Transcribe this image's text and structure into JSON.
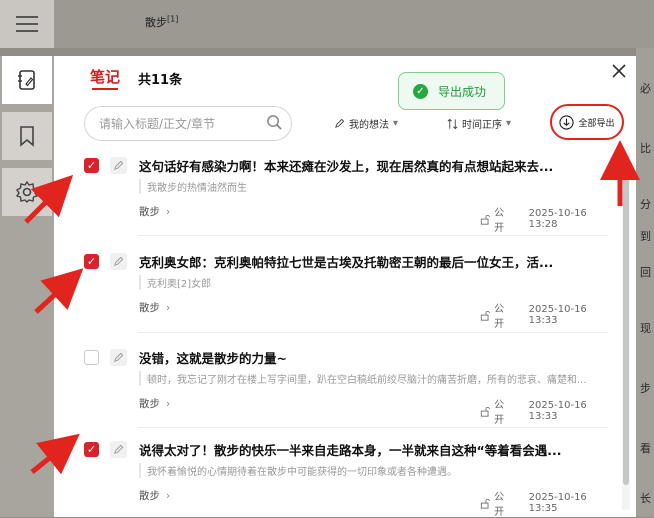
{
  "reader": {
    "bg_text": "散步",
    "bg_sup": "[1]",
    "bg_glyphs": [
      "必",
      "比",
      "分",
      "到",
      "回",
      "现",
      "步",
      "看",
      "长"
    ]
  },
  "sidebar": {
    "items": [
      {
        "name": "notes",
        "icon": "notebook-icon",
        "active": true
      },
      {
        "name": "bookmarks",
        "icon": "bookmark-icon",
        "active": false
      },
      {
        "name": "settings",
        "icon": "gear-icon",
        "active": false
      }
    ]
  },
  "panel": {
    "tab_label": "笔记",
    "count_label": "共11条",
    "toast_label": "导出成功",
    "search_placeholder": "请输入标题/正文/章节",
    "filter_mine": "我的想法",
    "filter_sort": "时间正序",
    "export_label": "全部导出"
  },
  "entries": [
    {
      "checked": true,
      "title": "这句话好有感染力啊！本来还瘫在沙发上，现在居然真的有点想站起来去...",
      "quote": "我散步的热情油然而生",
      "chapter": "散步",
      "visibility": "公开",
      "date": "2025-10-16 13:28"
    },
    {
      "checked": true,
      "title": "克利奥女郎：克利奥帕特拉七世是古埃及托勒密王朝的最后一位女王，活...",
      "quote": "克利奥[2]女郎",
      "chapter": "散步",
      "visibility": "公开",
      "date": "2025-10-16 13:33"
    },
    {
      "checked": false,
      "title": "没错，这就是散步的力量~",
      "quote": "顿时，我忘记了刚才在楼上写字间里，趴在空白稿纸前绞尽脑汁的痛苦折磨，所有的悲哀、痛楚和...",
      "chapter": "散步",
      "visibility": "公开",
      "date": "2025-10-16 13:33"
    },
    {
      "checked": true,
      "title": "说得太对了！散步的快乐一半来自走路本身，一半就来自这种“等着看会遇...",
      "quote": "我怀着愉悦的心情期待着在散步中可能获得的一切印象或者各种遭遇。",
      "chapter": "散步",
      "visibility": "公开",
      "date": "2025-10-16 13:35"
    }
  ],
  "colors": {
    "accent": "#d21f1f",
    "toast_green": "#1f9a3a",
    "annotation_red": "#e2241f"
  }
}
